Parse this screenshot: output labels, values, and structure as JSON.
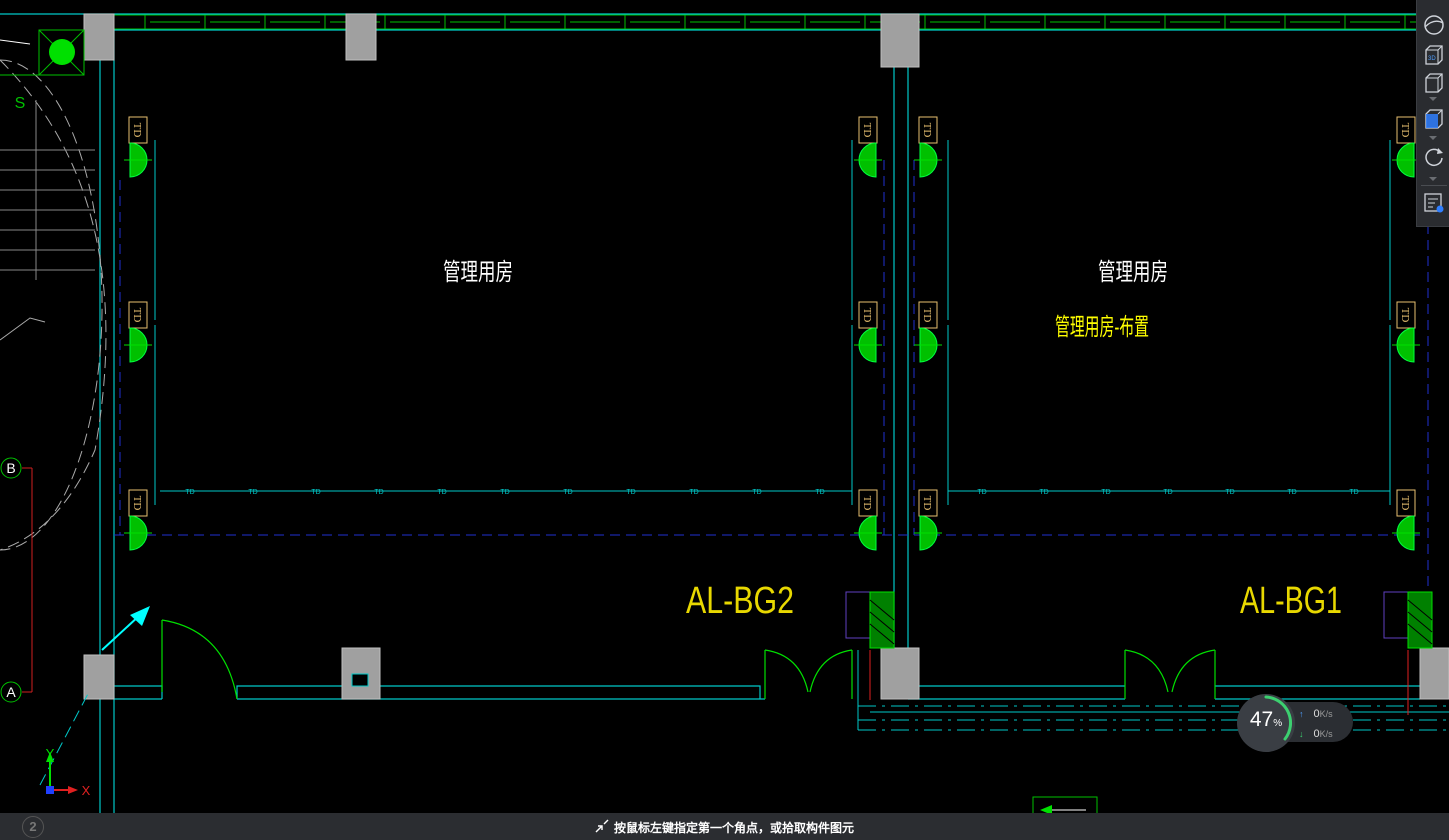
{
  "drawing": {
    "room_labels": [
      "管理用房",
      "管理用房"
    ],
    "layout_label": "管理用房-布置",
    "panel_labels": [
      "AL-BG2",
      "AL-BG1"
    ],
    "fixture_tag": "TD",
    "wire_tag": "TD",
    "grid_axes": [
      "B",
      "A"
    ],
    "stair_mark": "S",
    "ucs_x": "X",
    "ucs_y": "Y"
  },
  "toolbar": {
    "items": [
      "sphere-view-icon",
      "3d-view-icon",
      "box-view-icon",
      "cube-view-icon",
      "orbit-icon",
      "properties-icon"
    ]
  },
  "status": {
    "prompt": "按鼠标左键指定第一个角点，或拾取构件图元",
    "layout_tab": "2"
  },
  "netmon": {
    "percent": "47",
    "percent_sign": "%",
    "upload": "0",
    "download": "0",
    "unit": "K/s"
  },
  "colors": {
    "wall": "#00c8c8",
    "fixture": "#00e000",
    "label_white": "#ffffff",
    "label_yellow": "#ffff00",
    "panel_label": "#e8d800",
    "column": "#a0a0a0",
    "background": "#000000"
  }
}
